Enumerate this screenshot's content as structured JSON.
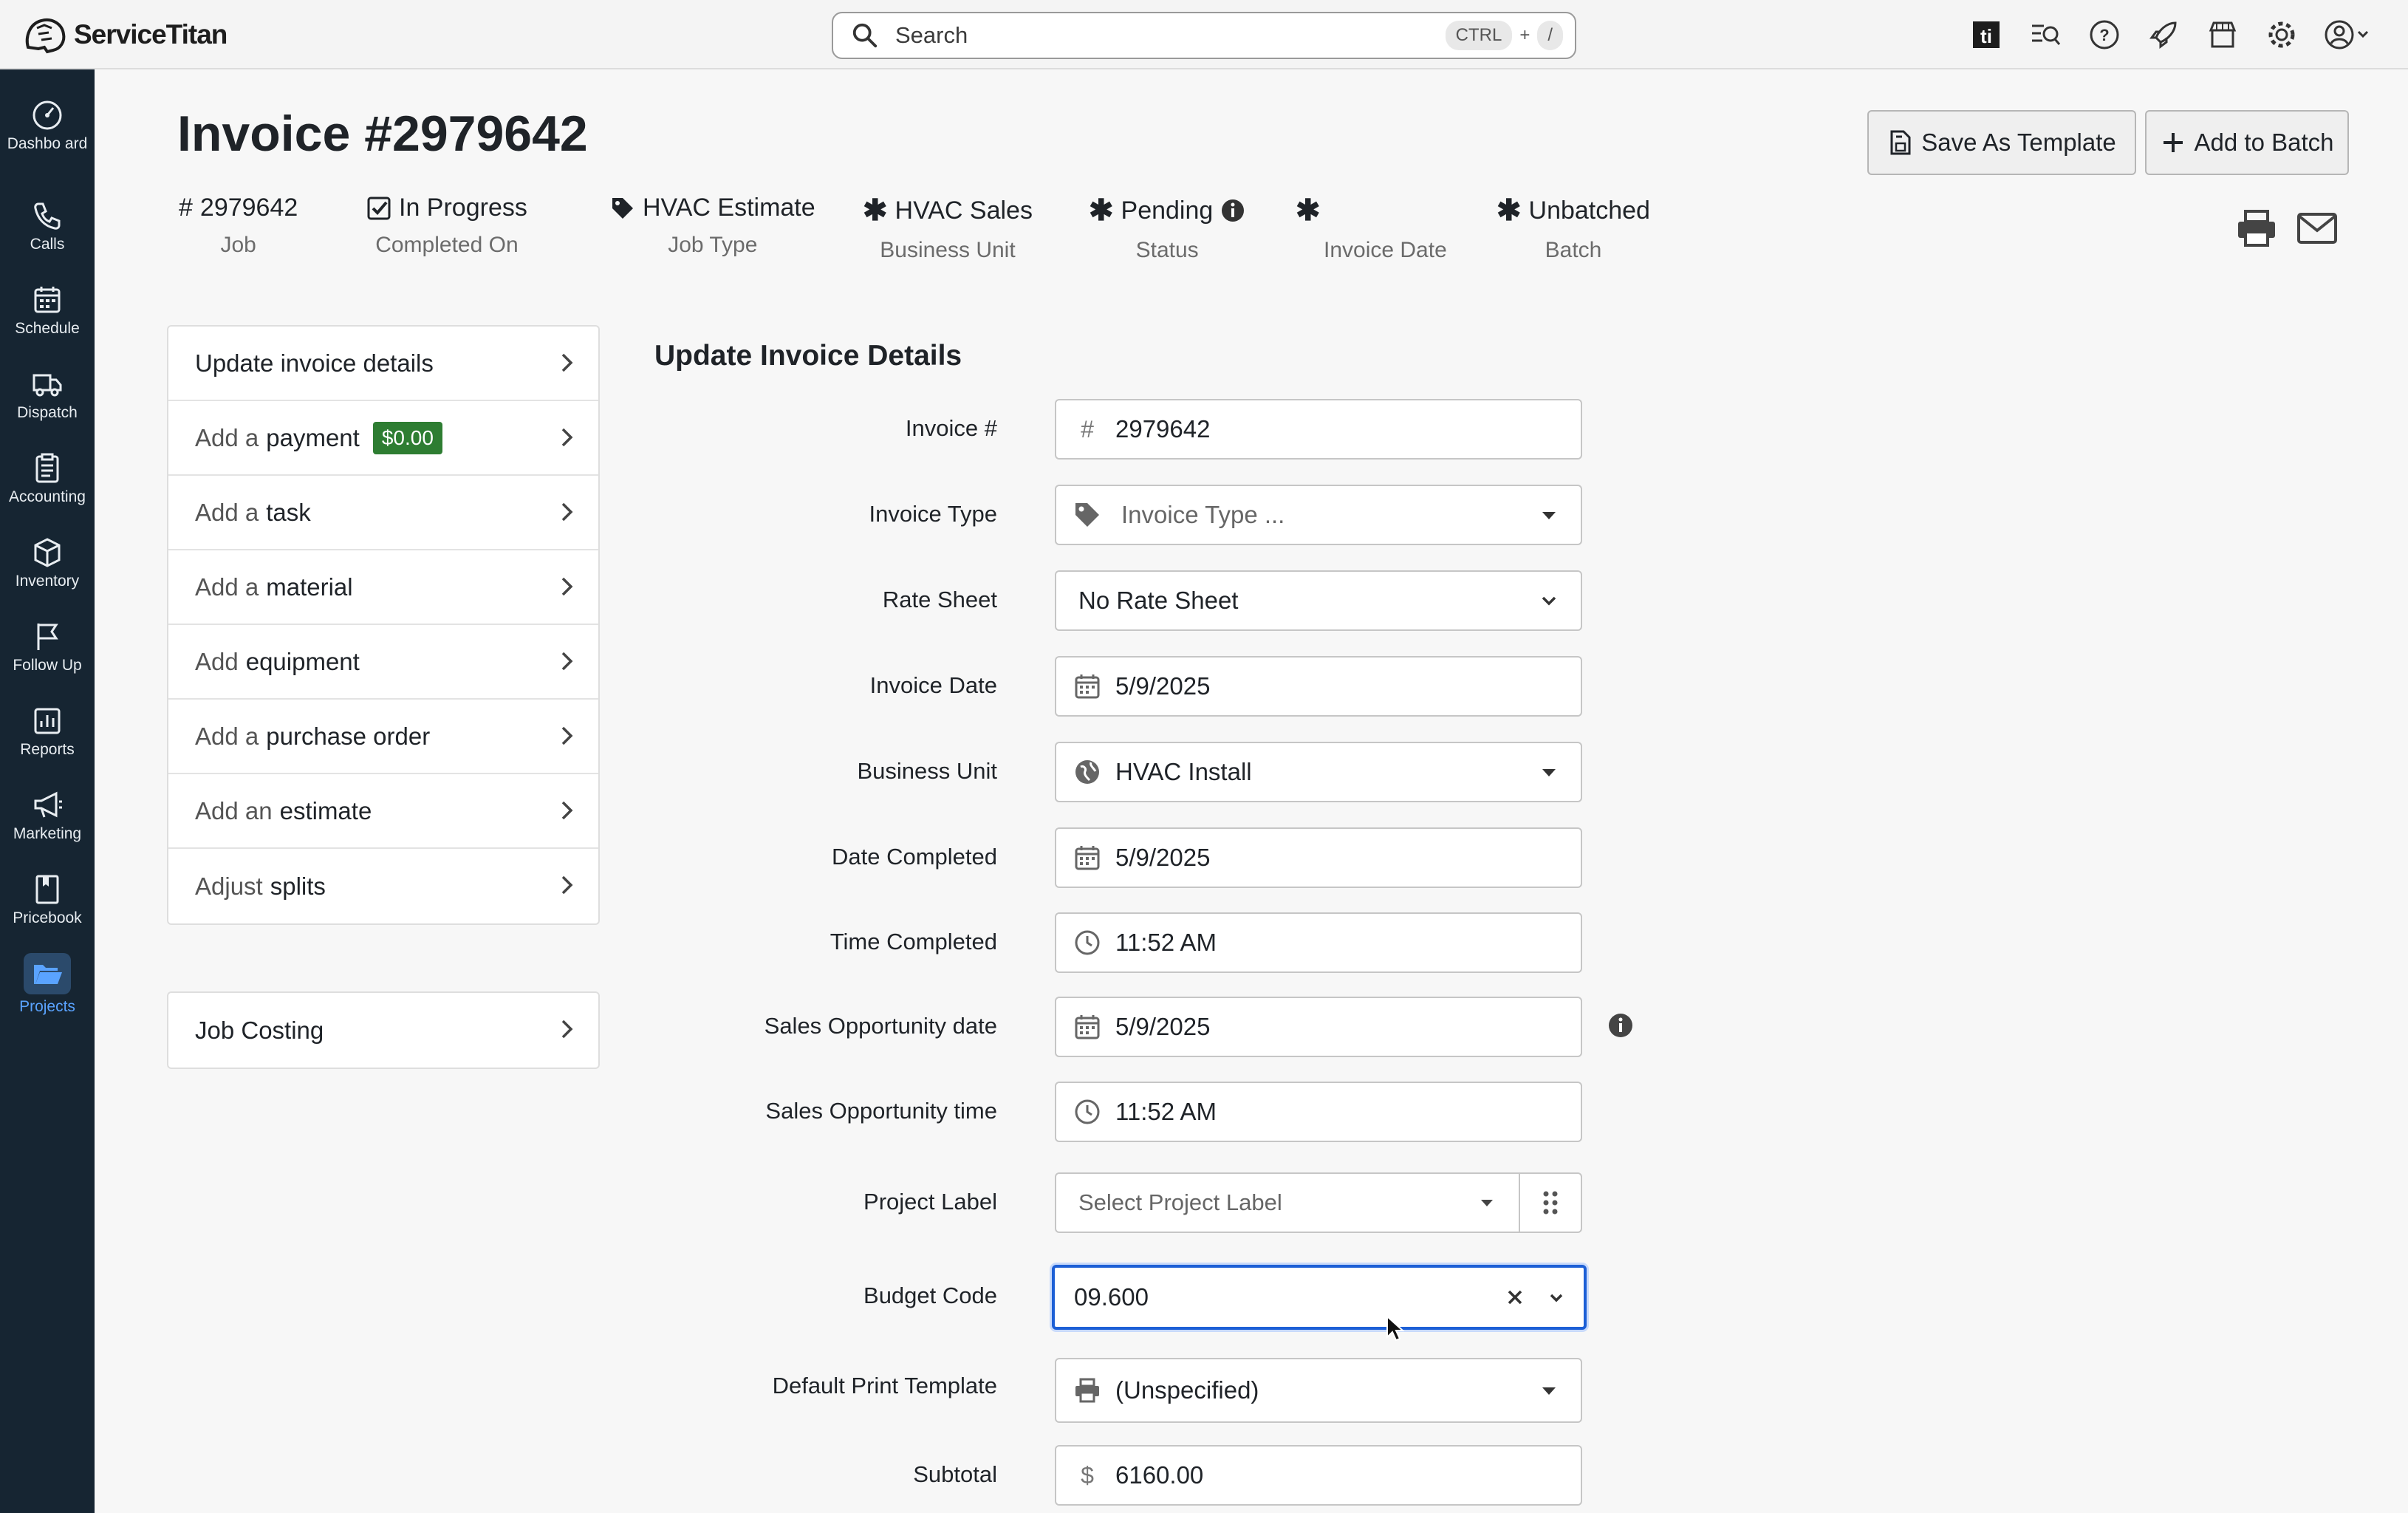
{
  "brand": {
    "name": "ServiceTitan"
  },
  "search": {
    "placeholder": "Search",
    "shortcut_key": "CTRL",
    "shortcut_plus": "+",
    "shortcut_slash": "/"
  },
  "top_icons": [
    "titan-icon",
    "search-list-icon",
    "help-icon",
    "rocket-icon",
    "marketplace-icon",
    "settings-icon",
    "account-icon"
  ],
  "sidebar": {
    "items": [
      {
        "label": "Dashbo ard",
        "icon": "dashboard-icon"
      },
      {
        "label": "Calls",
        "icon": "phone-icon"
      },
      {
        "label": "Schedule",
        "icon": "calendar-icon"
      },
      {
        "label": "Dispatch",
        "icon": "truck-icon"
      },
      {
        "label": "Accounting",
        "icon": "clipboard-icon"
      },
      {
        "label": "Inventory",
        "icon": "box-icon"
      },
      {
        "label": "Follow Up",
        "icon": "flag-icon"
      },
      {
        "label": "Reports",
        "icon": "chart-icon"
      },
      {
        "label": "Marketing",
        "icon": "megaphone-icon"
      },
      {
        "label": "Pricebook",
        "icon": "book-icon"
      },
      {
        "label": "Projects",
        "icon": "folder-icon",
        "active": true
      }
    ]
  },
  "header": {
    "title": "Invoice #2979642",
    "save_template": "Save As Template",
    "add_to_batch": "Add to Batch",
    "meta": {
      "job": {
        "value": "2979642",
        "label": "Job",
        "prefix": "#"
      },
      "completed": {
        "value": "In Progress",
        "label": "Completed On"
      },
      "job_type": {
        "value": "HVAC Estimate",
        "label": "Job Type"
      },
      "business_unit": {
        "value": "HVAC Sales",
        "label": "Business Unit"
      },
      "status": {
        "value": "Pending",
        "label": "Status"
      },
      "invoice_date": {
        "value": "",
        "label": "Invoice Date"
      },
      "batch": {
        "value": "Unbatched",
        "label": "Batch"
      }
    }
  },
  "actions": {
    "update": {
      "label": "Update invoice details"
    },
    "payment": {
      "prefix": "Add a",
      "label": "payment",
      "badge": "$0.00"
    },
    "task": {
      "prefix": "Add a",
      "label": "task"
    },
    "material": {
      "prefix": "Add a",
      "label": "material"
    },
    "equipment": {
      "prefix": "Add",
      "label": "equipment"
    },
    "purchase_order": {
      "prefix": "Add a",
      "label": "purchase order"
    },
    "estimate": {
      "prefix": "Add an",
      "label": "estimate"
    },
    "splits": {
      "prefix": "Adjust",
      "label": "splits"
    },
    "job_costing": {
      "label": "Job Costing"
    }
  },
  "form": {
    "title": "Update Invoice Details",
    "invoice_number": {
      "label": "Invoice #",
      "prefix": "#",
      "value": "2979642"
    },
    "invoice_type": {
      "label": "Invoice Type",
      "placeholder": "Invoice Type ..."
    },
    "rate_sheet": {
      "label": "Rate Sheet",
      "value": "No Rate Sheet"
    },
    "invoice_date": {
      "label": "Invoice Date",
      "value": "5/9/2025"
    },
    "business_unit": {
      "label": "Business Unit",
      "value": "HVAC Install"
    },
    "date_completed": {
      "label": "Date Completed",
      "value": "5/9/2025"
    },
    "time_completed": {
      "label": "Time Completed",
      "value": "11:52 AM"
    },
    "sales_opp_date": {
      "label": "Sales Opportunity date",
      "value": "5/9/2025"
    },
    "sales_opp_time": {
      "label": "Sales Opportunity time",
      "value": "11:52 AM"
    },
    "project_label": {
      "label": "Project Label",
      "placeholder": "Select Project Label"
    },
    "budget_code": {
      "label": "Budget Code",
      "value": "09.600"
    },
    "print_template": {
      "label": "Default Print Template",
      "value": "(Unspecified)"
    },
    "subtotal": {
      "label": "Subtotal",
      "prefix": "$",
      "value": "6160.00"
    }
  },
  "colors": {
    "sidebar_bg": "#162532",
    "active_nav": "#5aa3ff",
    "focus": "#1c5fd6",
    "badge": "#2e7d32"
  }
}
